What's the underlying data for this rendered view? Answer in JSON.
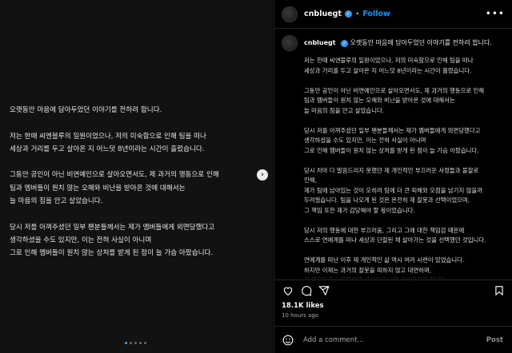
{
  "media": {
    "paragraphs": [
      [
        "오랫동안 마음에 담아두었던 이야기를 전하려 합니다."
      ],
      [
        "저는 한때 씨엔블루의 일원이었으나, 저의 미숙함으로 인해 팀을 떠나",
        "세상과 거리를 두고 살아온 지 어느덧 8년이라는 시간이 흘렀습니다."
      ],
      [
        "그동안 공인이 아닌 비연예인으로 살아오면서도, 제 과거의 행동으로 인해",
        "팀과 멤버들이 원치 않는 오해와 비난을 받아온 것에 대해서는",
        "늘 마음의 짐을 안고 살았습니다."
      ],
      [
        "당시 저를 아껴주셨던 일부 팬분들께서는 제가 멤버들에게 외면당했다고",
        "생각하셨을 수도 있지만, 이는 전혀 사실이 아니며",
        "그로 인해 멤버들이 원치 않는 상처를 받게 된 점이 늘 가슴 아팠습니다."
      ]
    ],
    "next_button": "›",
    "dots_total": 5,
    "dots_active": 0
  },
  "header": {
    "username": "cnbluegt",
    "separator": "•",
    "follow_label": "Follow",
    "more_label": "•••"
  },
  "caption": {
    "username": "cnbluegt",
    "first_line": "오랫동안 마음에 담아두었던 이야기를 전하려 합니다.",
    "paragraphs": [
      [
        "저는 한때 씨엔블루의 일원이었으나, 저의 미숙함으로 인해 팀을 떠나",
        "세상과 거리를 두고 살아온 지 어느덧 8년이라는 시간이 흘렀습니다."
      ],
      [
        "그동안 공인이 아닌 비연예인으로 살아오면서도, 제 과거의 행동으로 인해",
        "팀과 멤버들이 원치 않는 오해와 비난을 받아온 것에 대해서는",
        "늘 마음의 짐을 안고 살았습니다."
      ],
      [
        "당시 저를 아껴주셨던 일부 팬분들께서는 제가 멤버들에게 외면당했다고",
        "생각하셨을 수도 있지만, 이는 전혀 사실이 아니며",
        "그로 인해 멤버들이 원치 않는 상처를 받게 된 점이 늘 가슴 아팠습니다."
      ],
      [
        "당시 차마 다 말씀드리지 못했던 제 개인적인 부끄러운 사정들과 불찰로",
        "인해,",
        "제가 팀에 남아있는 것이 오히려 팀에 더 큰 피해와 오점을 남기지 않을까",
        "두려웠습니다. 팀을 나오게 된 것은 온전히 제 잘못과 선택이었으며,",
        "그 책임 또한 제가 감당해야 할 몫이었습니다."
      ],
      [
        "당시 저의 행동에 대한 부끄러움, 그리고 그에 대한 책임감 때문에",
        "스스로 연예계를 떠나 세상과 단절된 채 살아가는 것을 선택했던 것입니다."
      ],
      [
        "연예계를 떠난 이후 제 개인적인 삶 역시 여러 시련이 있었습니다.",
        "하지만 이제는 과거의 잘못을 피하지 않고 대면하며,",
        "한 인간으로서 떳떳하게 세상으로 나와 살아가고자 합니다."
      ],
      [
        "이 글은 연예계에 복귀를 위해 쓰는 글이 결코 아닙니다."
      ]
    ]
  },
  "stats": {
    "likes": "18.1K likes",
    "time": "10 hours ago"
  },
  "comment": {
    "placeholder": "Add a comment...",
    "post_label": "Post"
  },
  "colors": {
    "accent": "#0095f6",
    "verified": "#3897f0",
    "active_dot": "#4a9cf0"
  }
}
